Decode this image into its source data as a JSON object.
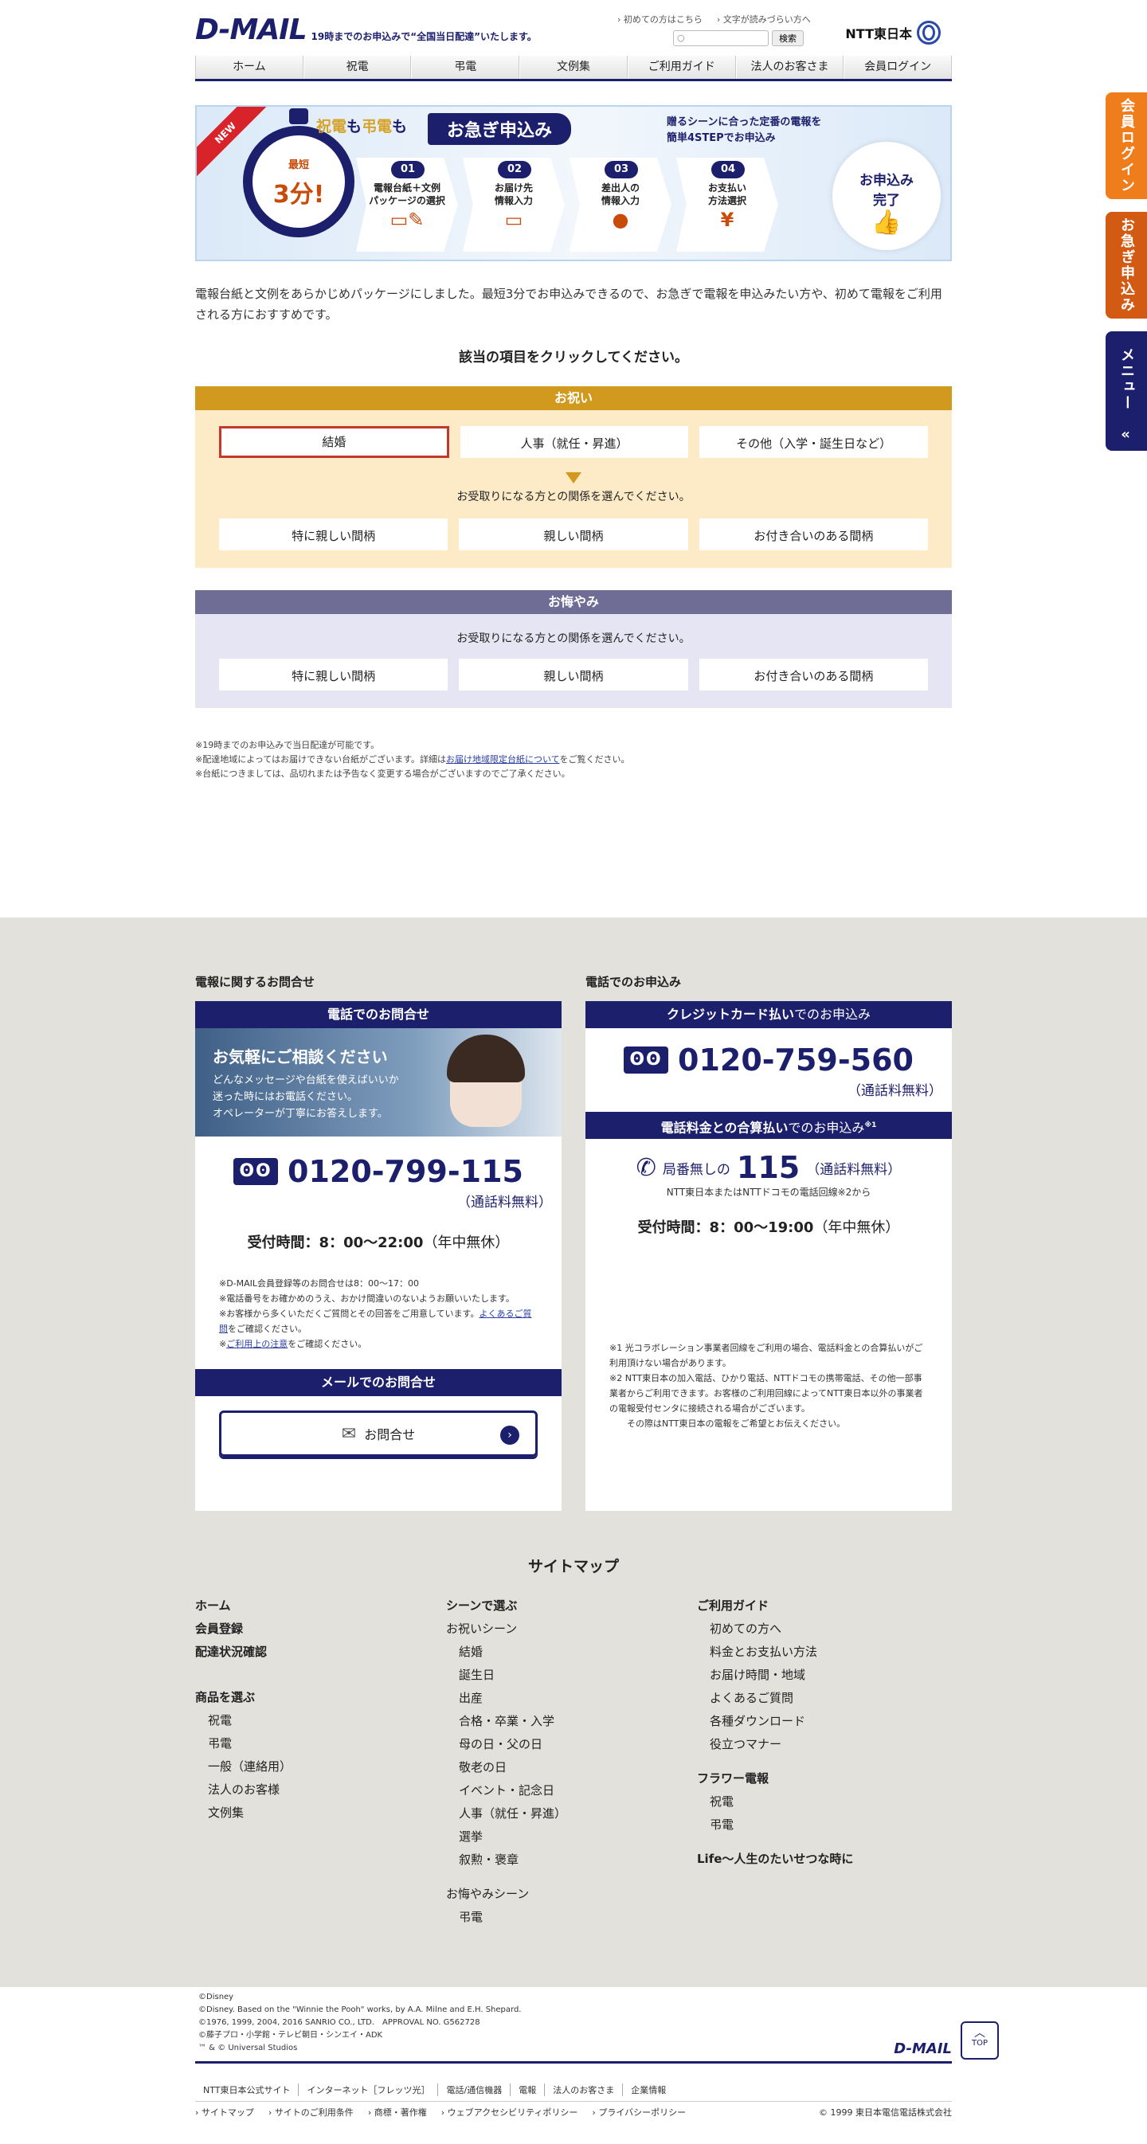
{
  "header": {
    "logo": "D-MAIL",
    "tagline": "19時までのお申込みで“全国当日配達”いたします。",
    "util_links": [
      "初めての方はこちら",
      "文字が読みづらい方へ"
    ],
    "search_placeholder": "",
    "search_button": "検索",
    "ntt": "NTT東日本"
  },
  "gnav": [
    "ホーム",
    "祝電",
    "弔電",
    "文例集",
    "ご利用ガイド",
    "法人のお客さま",
    "会員ログイン"
  ],
  "banner": {
    "new": "NEW",
    "title_a": "祝電",
    "title_b": "も",
    "title_c": "弔電",
    "title_d": "も",
    "pill": "お急ぎ申込み",
    "right_1": "贈るシーンに合った定番の電報を",
    "right_2": "簡単4STEPでお申込み",
    "clock_small": "最短",
    "clock_big": "3分!",
    "steps": [
      {
        "num": "01",
        "label_1": "電報台紙＋文例",
        "label_2": "パッケージの選択"
      },
      {
        "num": "02",
        "label_1": "お届け先",
        "label_2": "情報入力"
      },
      {
        "num": "03",
        "label_1": "差出人の",
        "label_2": "情報入力"
      },
      {
        "num": "04",
        "label_1": "お支払い",
        "label_2": "方法選択"
      }
    ],
    "done_1": "お申込み",
    "done_2": "完了"
  },
  "intro": "電報台紙と文例をあらかじめパッケージにしました。最短3分でお申込みできるので、お急ぎで電報を申込みたい方や、初めて電報をご利用される方におすすめです。",
  "lead": "該当の項目をクリックしてください。",
  "celebrate": {
    "title": "お祝い",
    "options": [
      "結婚",
      "人事（就任・昇進）",
      "その他（入学・誕生日など）"
    ],
    "prompt": "お受取りになる方との関係を選んでください。",
    "relations": [
      "特に親しい間柄",
      "親しい間柄",
      "お付き合いのある間柄"
    ]
  },
  "mourn": {
    "title": "お悔やみ",
    "prompt": "お受取りになる方との関係を選んでください。",
    "relations": [
      "特に親しい間柄",
      "親しい間柄",
      "お付き合いのある間柄"
    ]
  },
  "notes": {
    "n1": "※19時までのお申込みで当日配達が可能です。",
    "n2_a": "※配達地域によってはお届けできない台紙がございます。詳細は",
    "n2_link": "お届け地域限定台紙について",
    "n2_b": "をご覧ください。",
    "n3": "※台紙につきましては、品切れまたは予告なく変更する場合がございますのでご了承ください。"
  },
  "contact_left": {
    "col_title": "電報に関するお問合せ",
    "head": "電話でのお問合せ",
    "photo_title": "お気軽にご相談ください",
    "photo_1": "どんなメッセージや台紙を使えばいいか",
    "photo_2": "迷った時にはお電話ください。",
    "photo_3": "オペレーターが丁寧にお答えします。",
    "number": "0120-799-115",
    "free": "（通話料無料）",
    "hours_label": "受付時間：8：00〜22:00",
    "hours_note": "（年中無休）",
    "mini_1": "※D-MAIL会員登録等のお問合せは8：00〜17：00",
    "mini_2": "※電話番号をお確かめのうえ、おかけ間違いのないようお願いいたします。",
    "mini_3_a": "※お客様から多くいただくご質問とその回答をご用意しています。",
    "mini_3_link": "よくあるご質問",
    "mini_3_b": "をご確認ください。",
    "mini_4_a": "※",
    "mini_4_link": "ご利用上の注意",
    "mini_4_b": "をご確認ください。",
    "mail_head": "メールでのお問合せ",
    "mail_button": "お問合せ"
  },
  "contact_right": {
    "col_title": "電話でのお申込み",
    "head1_a": "クレジットカード払い",
    "head1_b": "でのお申込み",
    "number": "0120-759-560",
    "free": "（通話料無料）",
    "head2_a": "電話料金との合算払い",
    "head2_b": "でのお申込み",
    "head2_sup": "※1",
    "local": "局番無しの",
    "num115": "115",
    "free2": "（通話料無料）",
    "sub": "NTT東日本またはNTTドコモの電話回線※2から",
    "hours_label": "受付時間：8：00〜19:00",
    "hours_note": "（年中無休）",
    "fn1": "※1 光コラボレーション事業者回線をご利用の場合、電話料金との合算払いがご利用頂けない場合があります。",
    "fn2": "※2 NTT東日本の加入電話、ひかり電話、NTTドコモの携帯電話、その他一部事業者からご利用できます。お客様のご利用回線によってNTT東日本以外の事業者の電報受付センタに接続される場合がございます。",
    "fn3": "その際はNTT東日本の電報をご希望とお伝えください。"
  },
  "sitemap": {
    "title": "サイトマップ",
    "col1_heads": [
      "ホーム",
      "会員登録",
      "配達状況確認"
    ],
    "col1_group": "商品を選ぶ",
    "col1_items": [
      "祝電",
      "弔電",
      "一般（連絡用）",
      "法人のお客様",
      "文例集"
    ],
    "col2_head": "シーンで選ぶ",
    "col2_sub1": "お祝いシーン",
    "col2_items1": [
      "結婚",
      "誕生日",
      "出産",
      "合格・卒業・入学",
      "母の日・父の日",
      "敬老の日",
      "イベント・記念日",
      "人事（就任・昇進）",
      "選挙",
      "叙勲・褒章"
    ],
    "col2_sub2": "お悔やみシーン",
    "col2_items2": [
      "弔電"
    ],
    "col3_head": "ご利用ガイド",
    "col3_items": [
      "初めての方へ",
      "料金とお支払い方法",
      "お届け時間・地域",
      "よくあるご質問",
      "各種ダウンロード",
      "役立つマナー"
    ],
    "col3_head2": "フラワー電報",
    "col3_items2": [
      "祝電",
      "弔電"
    ],
    "col3_head3": "Life〜人生のたいせつな時に"
  },
  "copyright": [
    "©Disney",
    "©Disney. Based on the \"Winnie the Pooh\" works, by A.A. Milne and E.H. Shepard.",
    "©1976, 1999, 2004, 2016 SANRIO CO., LTD.　APPROVAL NO. G562728",
    "©藤子プロ・小学館・テレビ朝日・シンエイ・ADK",
    "™ & © Universal Studios"
  ],
  "footer_logo": "D-MAIL",
  "footer_links1": [
    "NTT東日本公式サイト",
    "インターネット［フレッツ光］",
    "電話/通信機器",
    "電報",
    "法人のお客さま",
    "企業情報"
  ],
  "footer_links2": [
    "サイトマップ",
    "サイトのご利用条件",
    "商標・著作権",
    "ウェブアクセシビリティポリシー",
    "プライバシーポリシー"
  ],
  "corp": "© 1999 東日本電信電話株式会社",
  "top_button": "TOP",
  "side_tabs": [
    "会員ログイン",
    "お急ぎ申込み",
    "メニュー"
  ]
}
